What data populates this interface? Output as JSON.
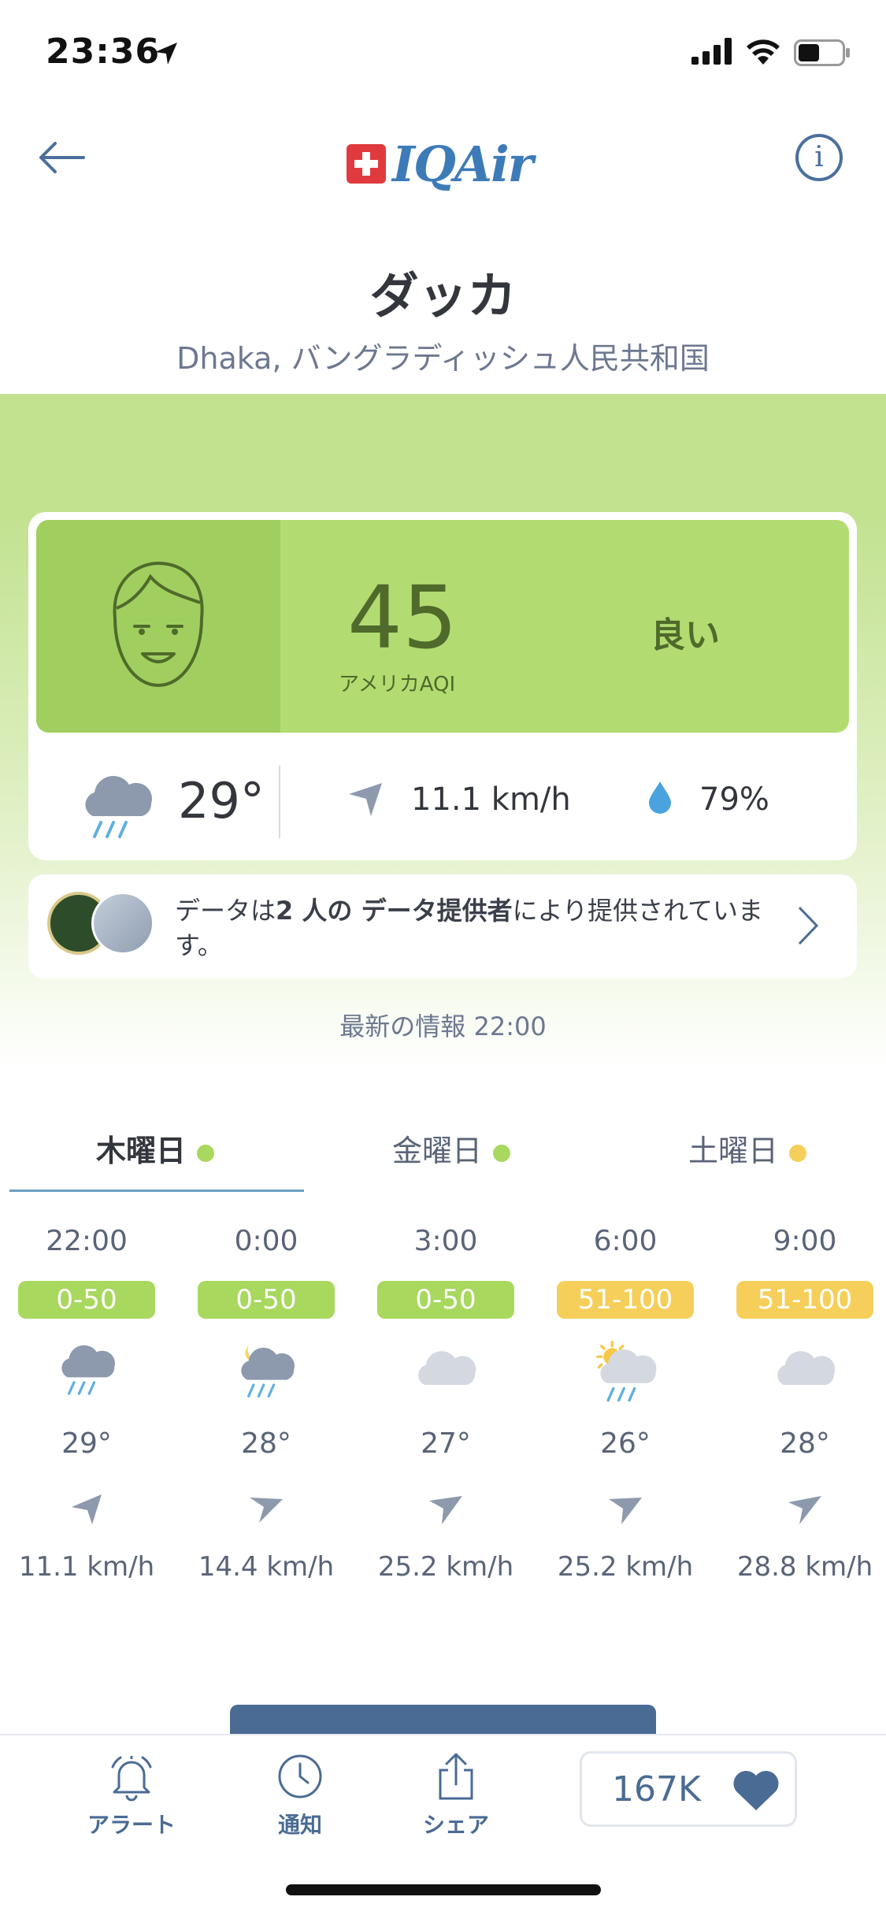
{
  "status_bar": {
    "time": "23:36"
  },
  "header": {
    "logo_text": "IQAir",
    "info_label": "i"
  },
  "city": {
    "name": "ダッカ",
    "subtitle": "Dhaka, バングラディッシュ人民共和国"
  },
  "aqi": {
    "value": "45",
    "label": "アメリカAQI",
    "status": "良い",
    "band_color": "#b2dc72"
  },
  "weather": {
    "temp": "29°",
    "wind": "11.1 km/h",
    "humidity": "79%"
  },
  "provider": {
    "text_before": "データは",
    "count": "2 人の",
    "text_mid": " データ提供者",
    "text_after": "により提供されています。"
  },
  "updated": "最新の情報 22:00",
  "tabs": [
    {
      "label": "木曜日",
      "dot": "#a8d85e",
      "active": true
    },
    {
      "label": "金曜日",
      "dot": "#a8d85e",
      "active": false
    },
    {
      "label": "土曜日",
      "dot": "#f5cf5a",
      "active": false
    }
  ],
  "forecast": [
    {
      "time": "22:00",
      "aqi": "0-50",
      "aqi_color": "#a8d85e",
      "icon": "rain-cloud-icon",
      "temp": "29°",
      "wind": "11.1 km/h"
    },
    {
      "time": "0:00",
      "aqi": "0-50",
      "aqi_color": "#a8d85e",
      "icon": "moon-rain-cloud-icon",
      "temp": "28°",
      "wind": "14.4 km/h"
    },
    {
      "time": "3:00",
      "aqi": "0-50",
      "aqi_color": "#a8d85e",
      "icon": "cloud-icon",
      "temp": "27°",
      "wind": "25.2 km/h"
    },
    {
      "time": "6:00",
      "aqi": "51-100",
      "aqi_color": "#f5cf5a",
      "icon": "sun-rain-cloud-icon",
      "temp": "26°",
      "wind": "25.2 km/h"
    },
    {
      "time": "9:00",
      "aqi": "51-100",
      "aqi_color": "#f5cf5a",
      "icon": "cloud-icon",
      "temp": "28°",
      "wind": "28.8 km/h"
    }
  ],
  "nav": {
    "alert": "アラート",
    "notify": "通知",
    "share": "シェア",
    "likes": "167K"
  },
  "colors": {
    "accent": "#4a6b94",
    "good": "#a8d85e",
    "moderate": "#f5cf5a"
  }
}
